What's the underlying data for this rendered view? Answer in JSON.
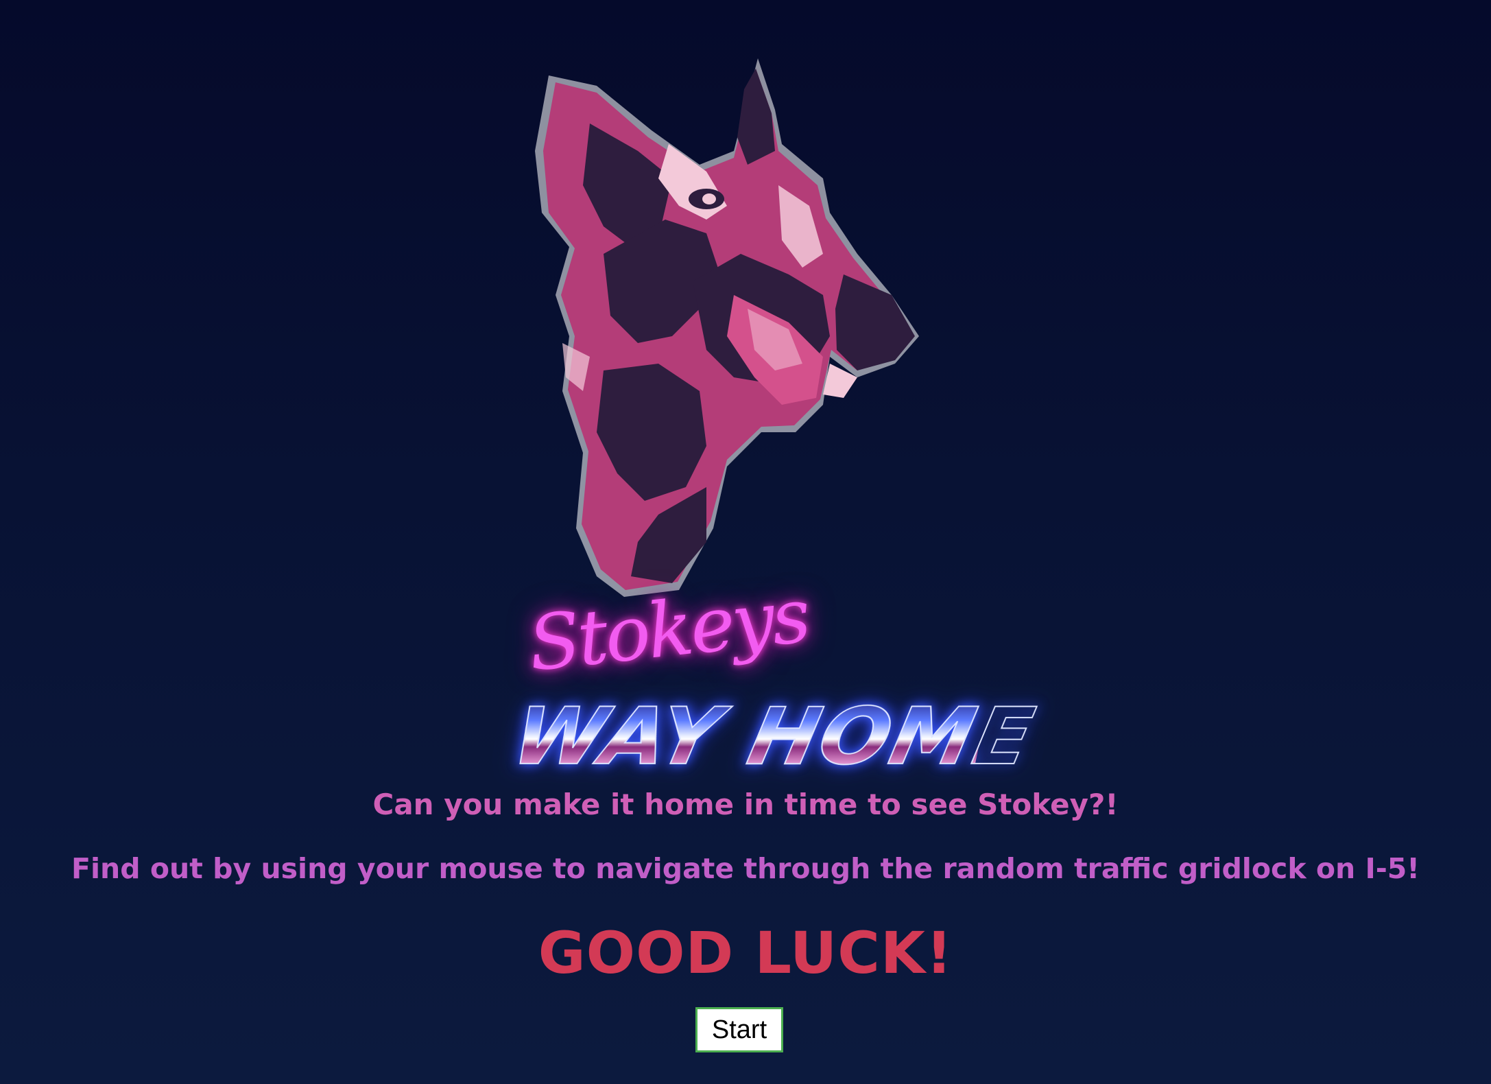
{
  "logo": {
    "script_word": "Stokeys",
    "chrome_word": "WAY HOME",
    "art_icon": "dog-head-icon"
  },
  "intro": {
    "line1": "Can you make it home in time to see Stokey?!",
    "line2": "Find out by using your mouse to navigate through the random traffic gridlock on I-5!"
  },
  "good_luck": "GOOD LUCK!",
  "start_button": "Start",
  "colors": {
    "background_top": "#050a2b",
    "background_bottom": "#0c1a3e",
    "intro_text": "#c46cd0",
    "good_luck": "#d33a55",
    "dog_primary": "#b43d78",
    "dog_dark": "#2e1d3e",
    "dog_highlight": "#f3c9d9",
    "neon_pink": "#f25cf0",
    "button_border": "#4caf50"
  }
}
